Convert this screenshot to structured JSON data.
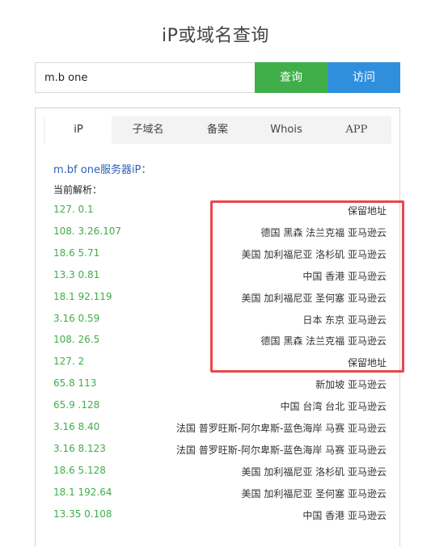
{
  "page": {
    "title": "iP或域名查询"
  },
  "search": {
    "value": "m.b one",
    "query_label": "查询",
    "visit_label": "访问"
  },
  "tabs": [
    {
      "label": "iP",
      "active": true
    },
    {
      "label": "子域名",
      "active": false
    },
    {
      "label": "备案",
      "active": false
    },
    {
      "label": "Whois",
      "active": false
    },
    {
      "label": "APP",
      "active": false
    }
  ],
  "results": {
    "server_ip_label": "m.bf one服务器iP：",
    "current_resolution_label": "当前解析：",
    "rows": [
      {
        "ip": "127. 0.1",
        "location": "保留地址",
        "highlighted": true
      },
      {
        "ip": "108. 3.26.107",
        "location": "德国 黑森 法兰克福 亚马逊云",
        "highlighted": true
      },
      {
        "ip": "18.6 5.71",
        "location": "美国 加利福尼亚 洛杉矶 亚马逊云",
        "highlighted": true
      },
      {
        "ip": "13.3 0.81",
        "location": "中国 香港 亚马逊云",
        "highlighted": true
      },
      {
        "ip": "18.1 92.119",
        "location": "美国 加利福尼亚 圣何塞 亚马逊云",
        "highlighted": true
      },
      {
        "ip": "3.16 0.59",
        "location": "日本 东京 亚马逊云",
        "highlighted": true
      },
      {
        "ip": "108. 26.5",
        "location": "德国 黑森 法兰克福 亚马逊云",
        "highlighted": true
      },
      {
        "ip": "127. 2",
        "location": "保留地址",
        "highlighted": true
      },
      {
        "ip": "65.8 113",
        "location": "新加坡 亚马逊云",
        "highlighted": false
      },
      {
        "ip": "65.9 .128",
        "location": "中国 台湾 台北 亚马逊云",
        "highlighted": false
      },
      {
        "ip": "3.16 8.40",
        "location": "法国 普罗旺斯-阿尔卑斯-蓝色海岸 马赛 亚马逊云",
        "highlighted": false
      },
      {
        "ip": "3.16 8.123",
        "location": "法国 普罗旺斯-阿尔卑斯-蓝色海岸 马赛 亚马逊云",
        "highlighted": false
      },
      {
        "ip": "18.6 5.128",
        "location": "美国 加利福尼亚 洛杉矶 亚马逊云",
        "highlighted": false
      },
      {
        "ip": "18.1 192.64",
        "location": "美国 加利福尼亚 圣何塞 亚马逊云",
        "highlighted": false
      },
      {
        "ip": "13.35 0.108",
        "location": "中国 香港 亚马逊云",
        "highlighted": false
      }
    ]
  },
  "colors": {
    "query_button": "#3fae49",
    "visit_button": "#2f8fdd",
    "ip_text": "#3fae49",
    "server_label": "#2b62b5",
    "highlight_border": "#e8474d"
  }
}
